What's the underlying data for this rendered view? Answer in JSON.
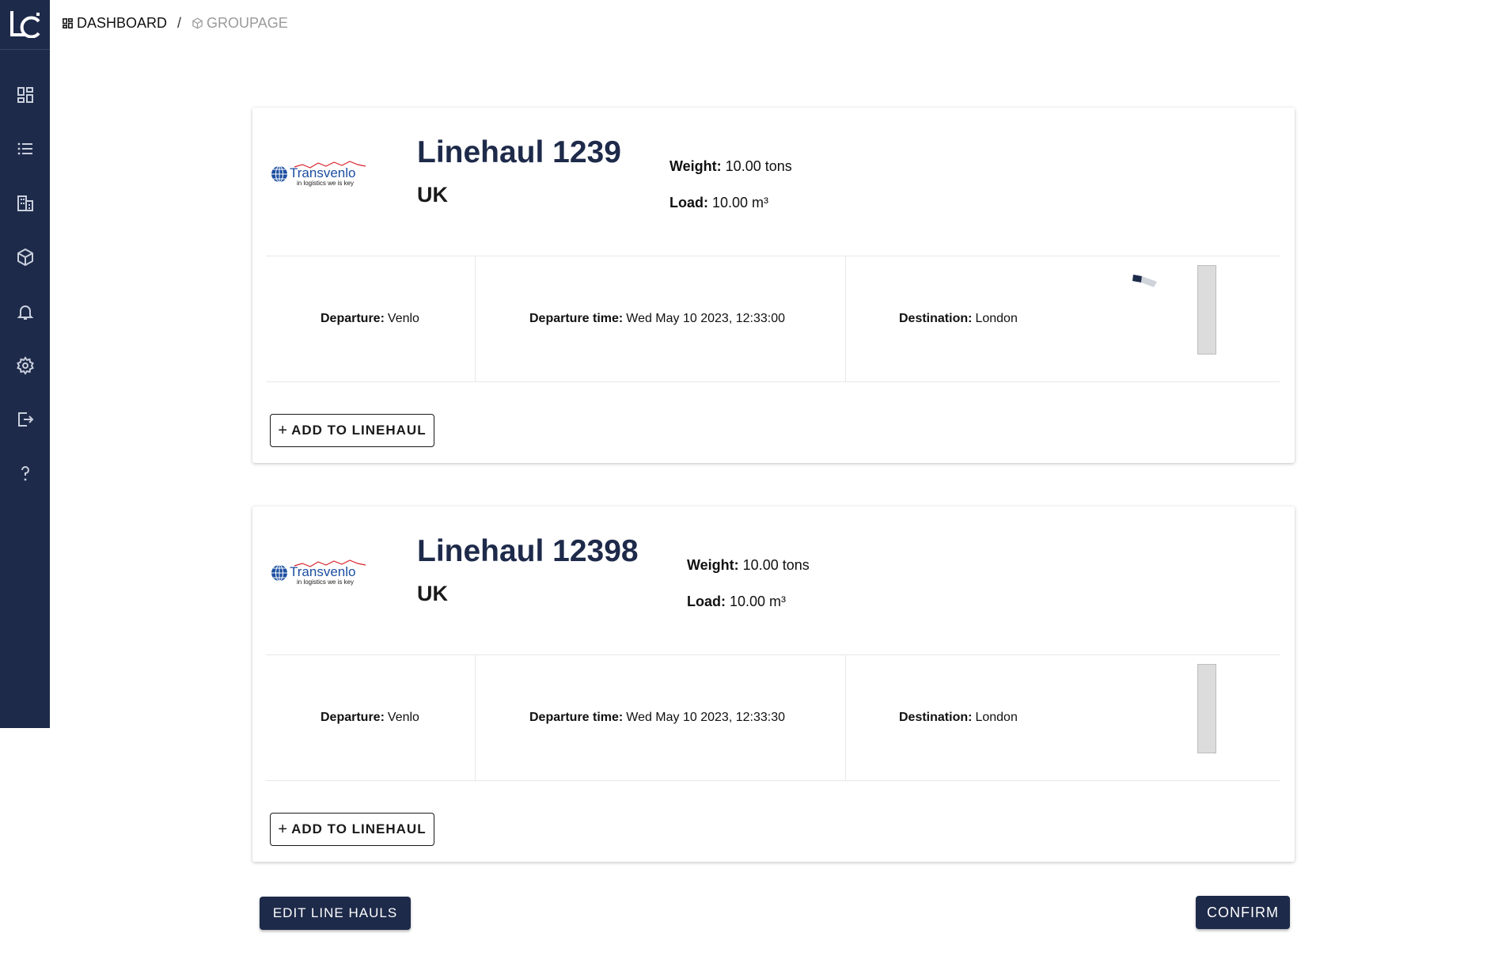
{
  "breadcrumb": {
    "items": [
      {
        "label": "DASHBOARD",
        "icon": "dashboard-icon"
      },
      {
        "label": "GROUPAGE",
        "icon": "cube-icon"
      }
    ],
    "separator": "/"
  },
  "sidebar": {
    "items": [
      {
        "icon": "dashboard-icon"
      },
      {
        "icon": "list-icon"
      },
      {
        "icon": "building-icon"
      },
      {
        "icon": "package-icon"
      },
      {
        "icon": "bell-icon"
      },
      {
        "icon": "gear-icon"
      },
      {
        "icon": "logout-icon"
      },
      {
        "icon": "help-icon"
      }
    ]
  },
  "labels": {
    "weight": "Weight:",
    "load": "Load:",
    "departure": "Departure:",
    "departure_time": "Departure time:",
    "destination": "Destination:",
    "add_button": "ADD TO LINEHAUL",
    "add_button_icon": "+"
  },
  "cards": [
    {
      "logo": {
        "brand": "Transvenlo",
        "tagline": "in logistics we is key"
      },
      "title": "Linehaul 1239",
      "region": "UK",
      "weight": "10.00 tons",
      "load": "10.00 m³",
      "departure": "Venlo",
      "departure_time": "Wed May 10 2023, 12:33:00",
      "destination": "London",
      "loading": true
    },
    {
      "logo": {
        "brand": "Transvenlo",
        "tagline": "in logistics we is key"
      },
      "title": "Linehaul 12398",
      "region": "UK",
      "weight": "10.00 tons",
      "load": "10.00 m³",
      "departure": "Venlo",
      "departure_time": "Wed May 10 2023, 12:33:30",
      "destination": "London",
      "loading": false
    }
  ],
  "actions": {
    "edit_label": "EDIT LINE HAULS",
    "confirm_label": "CONFIRM"
  },
  "colors": {
    "primary": "#1e2a4a",
    "muted": "#9a9a9a",
    "brand_blue": "#1b4ea0",
    "brand_red": "#d8232a"
  }
}
